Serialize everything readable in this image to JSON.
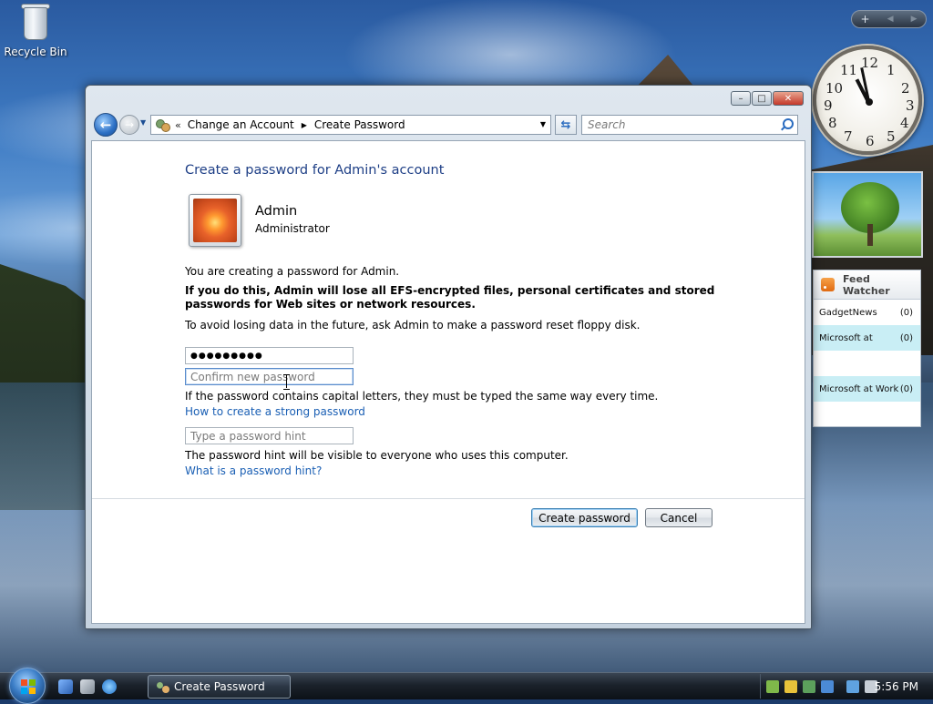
{
  "desktop": {
    "recycle_bin_label": "Recycle Bin"
  },
  "window": {
    "breadcrumb": {
      "overflow": "«",
      "items": [
        "Change an Account",
        "Create Password"
      ]
    },
    "search": {
      "placeholder": "Search"
    },
    "heading": "Create a password for Admin's account",
    "user": {
      "name": "Admin",
      "role": "Administrator"
    },
    "intro_text": "You are creating a password for Admin.",
    "warning_text": "If you do this, Admin will lose all EFS-encrypted files, personal certificates and stored passwords for Web sites or network resources.",
    "advice_text": "To avoid losing data in the future, ask Admin to make a password reset floppy disk.",
    "new_password": {
      "value": "●●●●●●●●●"
    },
    "confirm_password": {
      "placeholder": "Confirm new password"
    },
    "case_note": "If the password contains capital letters, they must be typed the same way every time.",
    "strong_password_link": "How to create a strong password",
    "hint_field": {
      "placeholder": "Type a password hint"
    },
    "hint_note": "The password hint will be visible to everyone who uses this computer.",
    "hint_link": "What is a password hint?",
    "create_button": "Create password",
    "cancel_button": "Cancel"
  },
  "gadgets": {
    "feed_watcher": {
      "title": "Feed Watcher",
      "items": [
        {
          "name": "GadgetNews",
          "count": "(0)"
        },
        {
          "name": "Microsoft at",
          "count": "(0)"
        },
        {
          "name": "Microsoft at Work",
          "count": "(0)"
        }
      ]
    },
    "clock_numbers": [
      "12",
      "1",
      "2",
      "3",
      "4",
      "5",
      "6",
      "7",
      "8",
      "9",
      "10",
      "11"
    ]
  },
  "taskbar": {
    "active_window": "Create Password",
    "time": "5:56 PM"
  }
}
